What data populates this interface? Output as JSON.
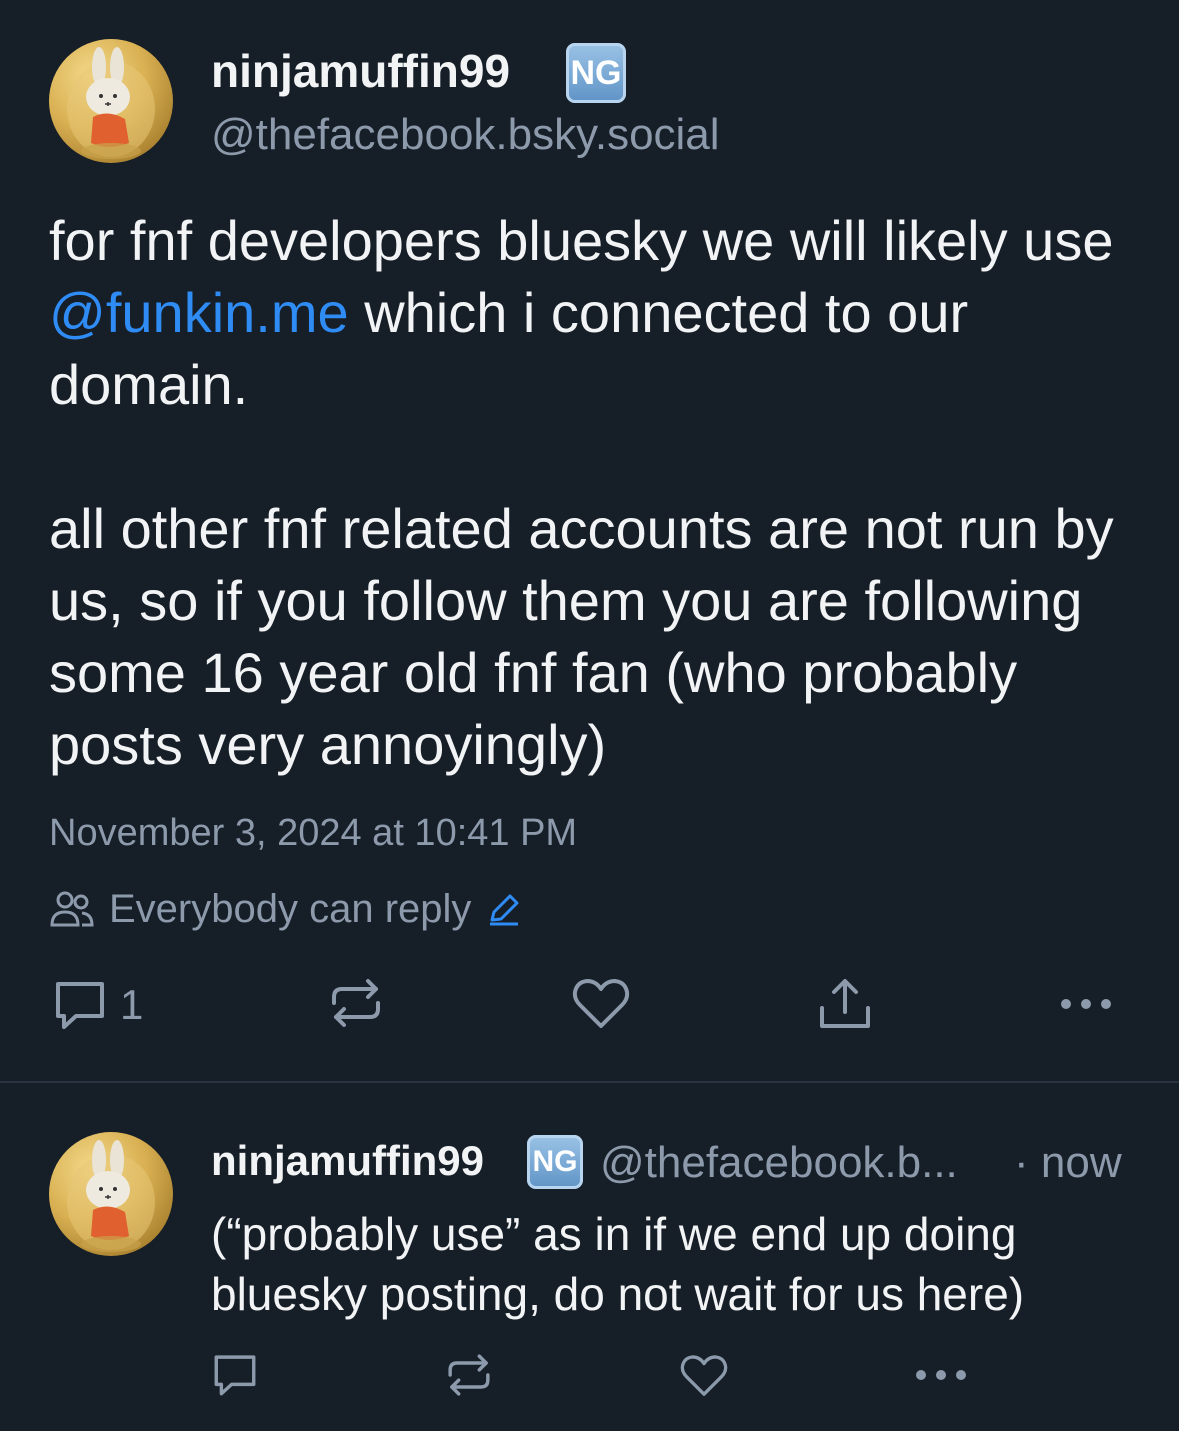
{
  "post": {
    "author": {
      "display_name": "ninjamuffin99",
      "badge": "NG",
      "handle": "@thefacebook.bsky.social"
    },
    "text": {
      "line1_before": "for fnf developers bluesky we will likely use ",
      "mention": "@funkin.me",
      "line1_after": " which i connected to our domain.",
      "paragraph2": "all other fnf related accounts are not run by us, so if you follow them you are following some 16 year old fnf fan (who probably posts very annoyingly)"
    },
    "timestamp": "November 3, 2024 at 10:41 PM",
    "reply_setting": "Everybody can reply",
    "actions": {
      "reply_count": "1",
      "reply_icon": "comment-icon",
      "repost_icon": "repost-icon",
      "like_icon": "heart-icon",
      "share_icon": "share-icon",
      "more_icon": "ellipsis-icon"
    }
  },
  "reply": {
    "author": {
      "display_name": "ninjamuffin99",
      "badge": "NG",
      "handle": "@thefacebook.b...",
      "time": "· now"
    },
    "text": "(“probably use” as in if we end up doing bluesky posting, do not wait for us here)"
  },
  "colors": {
    "background": "#161e27",
    "text": "#f1f3f5",
    "muted": "#8c9aab",
    "link": "#2f8cf5",
    "divider": "#2a3441"
  }
}
